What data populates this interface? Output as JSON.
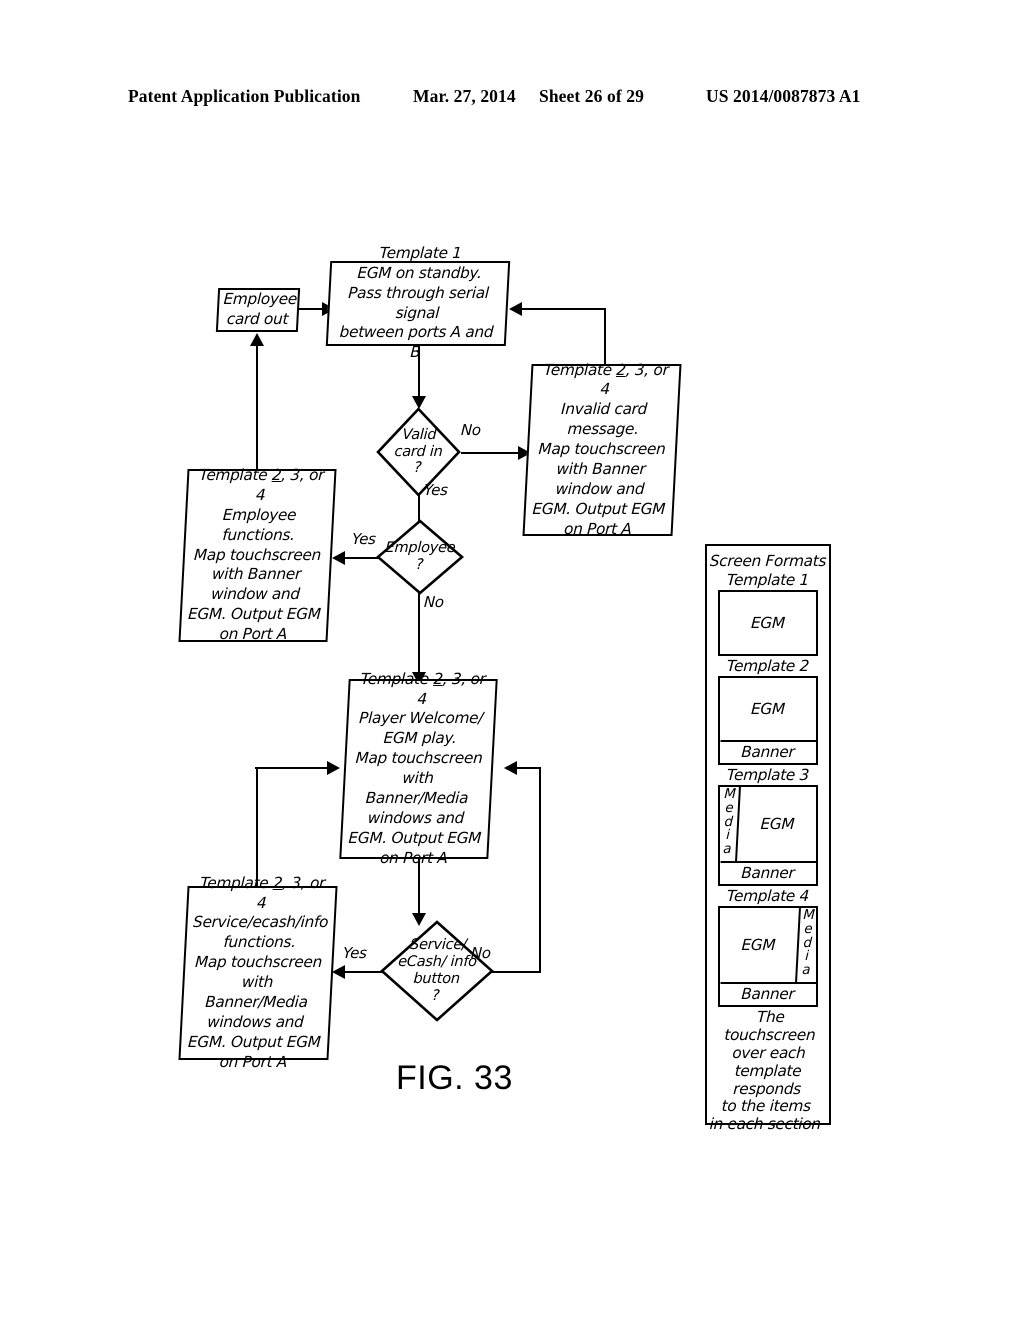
{
  "header": {
    "publication": "Patent Application Publication",
    "date": "Mar. 27, 2014",
    "sheet": "Sheet 26 of 29",
    "number": "US 2014/0087873 A1"
  },
  "figure": {
    "caption": "FIG. 33",
    "nodes": {
      "employee_card_out": "Employee\ncard out",
      "template1": "Template 1\nEGM on standby.\nPass through serial signal\nbetween ports A and B",
      "invalid_card": "Template 2, 3, or 4\nInvalid card\nmessage.\nMap touchscreen\nwith Banner\nwindow and\nEGM. Output EGM\non Port A",
      "employee_functions": "Template 2, 3, or 4\nEmployee\nfunctions.\nMap touchscreen\nwith Banner\nwindow and\nEGM. Output EGM\non Port A",
      "player_welcome": "Template 2, 3, or 4\nPlayer Welcome/\nEGM play.\nMap touchscreen\nwith Banner/Media\nwindows and\nEGM. Output EGM\non Port A",
      "service_ecash": "Template 2, 3, or 4\nService/ecash/info\nfunctions.\nMap touchscreen\nwith Banner/Media\nwindows and\nEGM. Output EGM\non Port A"
    },
    "decisions": {
      "valid_card": "Valid\ncard in\n?",
      "employee": "Employee\n?",
      "service_button": "Service/\neCash/ info\nbutton\n?"
    },
    "edge_labels": {
      "valid_card_no": "No",
      "valid_card_yes": "Yes",
      "employee_yes": "Yes",
      "employee_no": "No",
      "service_yes": "Yes",
      "service_no": "No"
    }
  },
  "legend": {
    "title": "Screen Formats",
    "templates": [
      {
        "name": "Template 1",
        "sections": [
          "EGM"
        ],
        "media_side": "none",
        "banner": false
      },
      {
        "name": "Template 2",
        "sections": [
          "EGM",
          "Banner"
        ],
        "media_side": "none",
        "banner": true,
        "banner_label": "Banner"
      },
      {
        "name": "Template 3",
        "sections": [
          "Media",
          "EGM",
          "Banner"
        ],
        "media_side": "left",
        "banner": true,
        "banner_label": "Banner",
        "media_label": "Media",
        "egm_label": "EGM"
      },
      {
        "name": "Template 4",
        "sections": [
          "EGM",
          "Media",
          "Banner"
        ],
        "media_side": "right",
        "banner": true,
        "banner_label": "Banner",
        "media_label": "Media",
        "egm_label": "EGM"
      }
    ],
    "egm_label": "EGM",
    "banner_label": "Banner",
    "media_label": "Media",
    "note": "The touchscreen\nover each\ntemplate responds\nto the items\nin each section"
  },
  "colors": {
    "ink": "#000000",
    "paper": "#ffffff"
  }
}
